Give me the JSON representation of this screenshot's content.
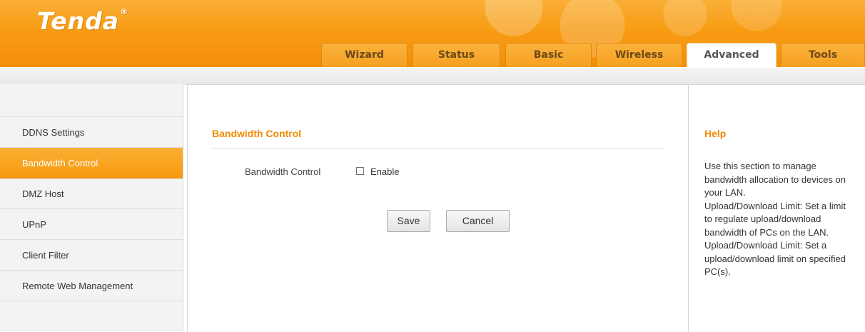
{
  "brand": {
    "logo": "Tenda",
    "reg": "®"
  },
  "tabs": [
    {
      "label": "Wizard"
    },
    {
      "label": "Status"
    },
    {
      "label": "Basic"
    },
    {
      "label": "Wireless"
    },
    {
      "label": "Advanced"
    },
    {
      "label": "Tools"
    }
  ],
  "active_tab": "Advanced",
  "sidebar": {
    "items": [
      {
        "label": "DDNS Settings"
      },
      {
        "label": "Bandwidth Control"
      },
      {
        "label": "DMZ Host"
      },
      {
        "label": "UPnP"
      },
      {
        "label": "Client Filter"
      },
      {
        "label": "Remote Web Management"
      }
    ],
    "active_item": "Bandwidth Control"
  },
  "main": {
    "title": "Bandwidth Control",
    "field_label": "Bandwidth Control",
    "checkbox_label": "Enable",
    "checkbox_checked": false,
    "save_label": "Save",
    "cancel_label": "Cancel"
  },
  "help": {
    "title": "Help",
    "paragraphs": [
      "Use this section to manage bandwidth allocation to devices on your LAN.",
      "Upload/Download Limit: Set a limit to regulate upload/download bandwidth of PCs on the LAN.",
      "Upload/Download Limit: Set a upload/download limit on specified PC(s)."
    ]
  },
  "colors": {
    "brand_orange": "#f79a12",
    "heading_orange": "#f08c00",
    "sidebar_bg": "#f3f3f3"
  }
}
